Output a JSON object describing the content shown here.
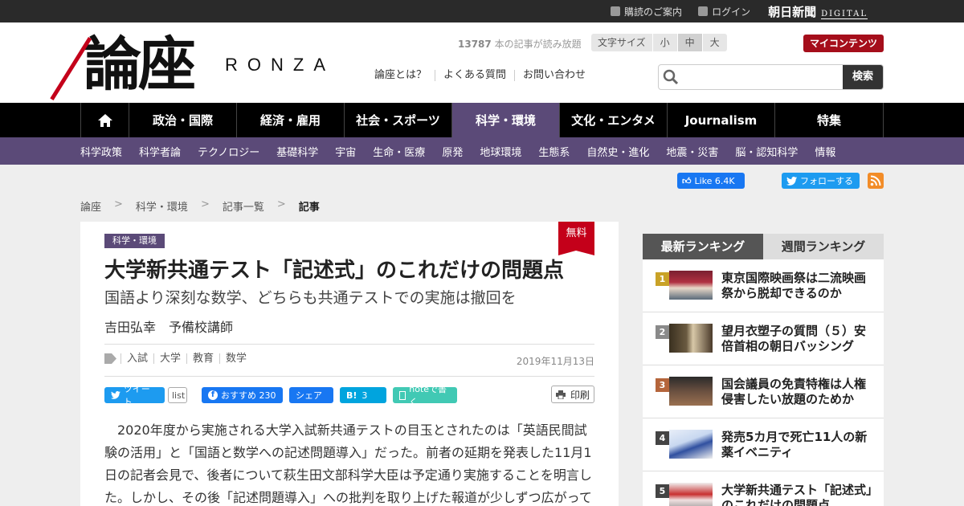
{
  "topbar": {
    "links": [
      {
        "label": "購読のご案内",
        "icon": "edit-icon"
      },
      {
        "label": "ログイン",
        "icon": "lock-icon"
      }
    ],
    "brand_main": "朝日新聞",
    "brand_sub": "DIGITAL"
  },
  "header": {
    "logo_kanji": "論座",
    "logo_latin": "RONZA",
    "read_count": "13787",
    "read_count_suffix": " 本の記事が読み放題",
    "font_size_label": "文字サイズ",
    "font_sizes": [
      "小",
      "中",
      "大"
    ],
    "font_size_selected": "中",
    "my_contents": "マイコンテンツ",
    "sublinks": [
      "論座とは？",
      "よくある質問",
      "お問い合わせ"
    ],
    "search_placeholder": "",
    "search_button": "検索"
  },
  "mainnav": [
    "政治・国際",
    "経済・雇用",
    "社会・スポーツ",
    "科学・環境",
    "文化・エンタメ",
    "Journalism",
    "特集"
  ],
  "mainnav_active": "科学・環境",
  "subnav": [
    "科学政策",
    "科学者論",
    "テクノロジー",
    "基礎科学",
    "宇宙",
    "生命・医療",
    "原発",
    "地球環境",
    "生態系",
    "自然史・進化",
    "地震・災害",
    "脳・認知科学",
    "情報"
  ],
  "social_top": {
    "fb": "Like 6.4K",
    "tw": "フォローする"
  },
  "breadcrumb": [
    "論座",
    "科学・環境",
    "記事一覧",
    "記事"
  ],
  "article": {
    "badge_free": "無料",
    "category": "科学・環境",
    "title": "大学新共通テスト「記述式」のこれだけの問題点",
    "subtitle": "国語より深刻な数学、どちらも共通テストでの実施は撤回を",
    "author": "吉田弘幸　予備校講師",
    "tags": [
      "入試",
      "大学",
      "教育",
      "数学"
    ],
    "date": "2019年11月13日",
    "share": {
      "tweet": "ツイート",
      "list": "list",
      "fb_recommend": "おすすめ 230",
      "fb_share": "シェア",
      "hatena": "3",
      "note": "noteで書く",
      "print": "印刷"
    },
    "body": "2020年度から実施される大学入試新共通テストの目玉とされたのは「英語民間試験の活用」と「国語と数学への記述問題導入」だった。前者の延期を発表した11月1日の記者会見で、後者について萩生田文部科学大臣は予定通り実施することを明言した。しかし、その後「記述問題導入」への批判を取り上げた報道が少しずつ広がって"
  },
  "ranking": {
    "tab_latest": "最新ランキング",
    "tab_weekly": "週間ランキング",
    "items": [
      {
        "rank": "1",
        "title": "東京国際映画祭は二流映画祭から脱却できるのか",
        "color": "#c9a227"
      },
      {
        "rank": "2",
        "title": "望月衣塑子の質問（５）安倍首相の朝日バッシング",
        "color": "#8a8a8a"
      },
      {
        "rank": "3",
        "title": "国会議員の免責特権は人権侵害したい放題のためか",
        "color": "#b5653b"
      },
      {
        "rank": "4",
        "title": "発売5カ月で死亡11人の新薬イベニティ",
        "color": "#444444"
      },
      {
        "rank": "5",
        "title": "大学新共通テスト「記述式」のこれだけの問題点",
        "color": "#444444"
      }
    ]
  },
  "colors": {
    "accent_purple": "#5b4a78",
    "brand_red": "#c4001a"
  }
}
